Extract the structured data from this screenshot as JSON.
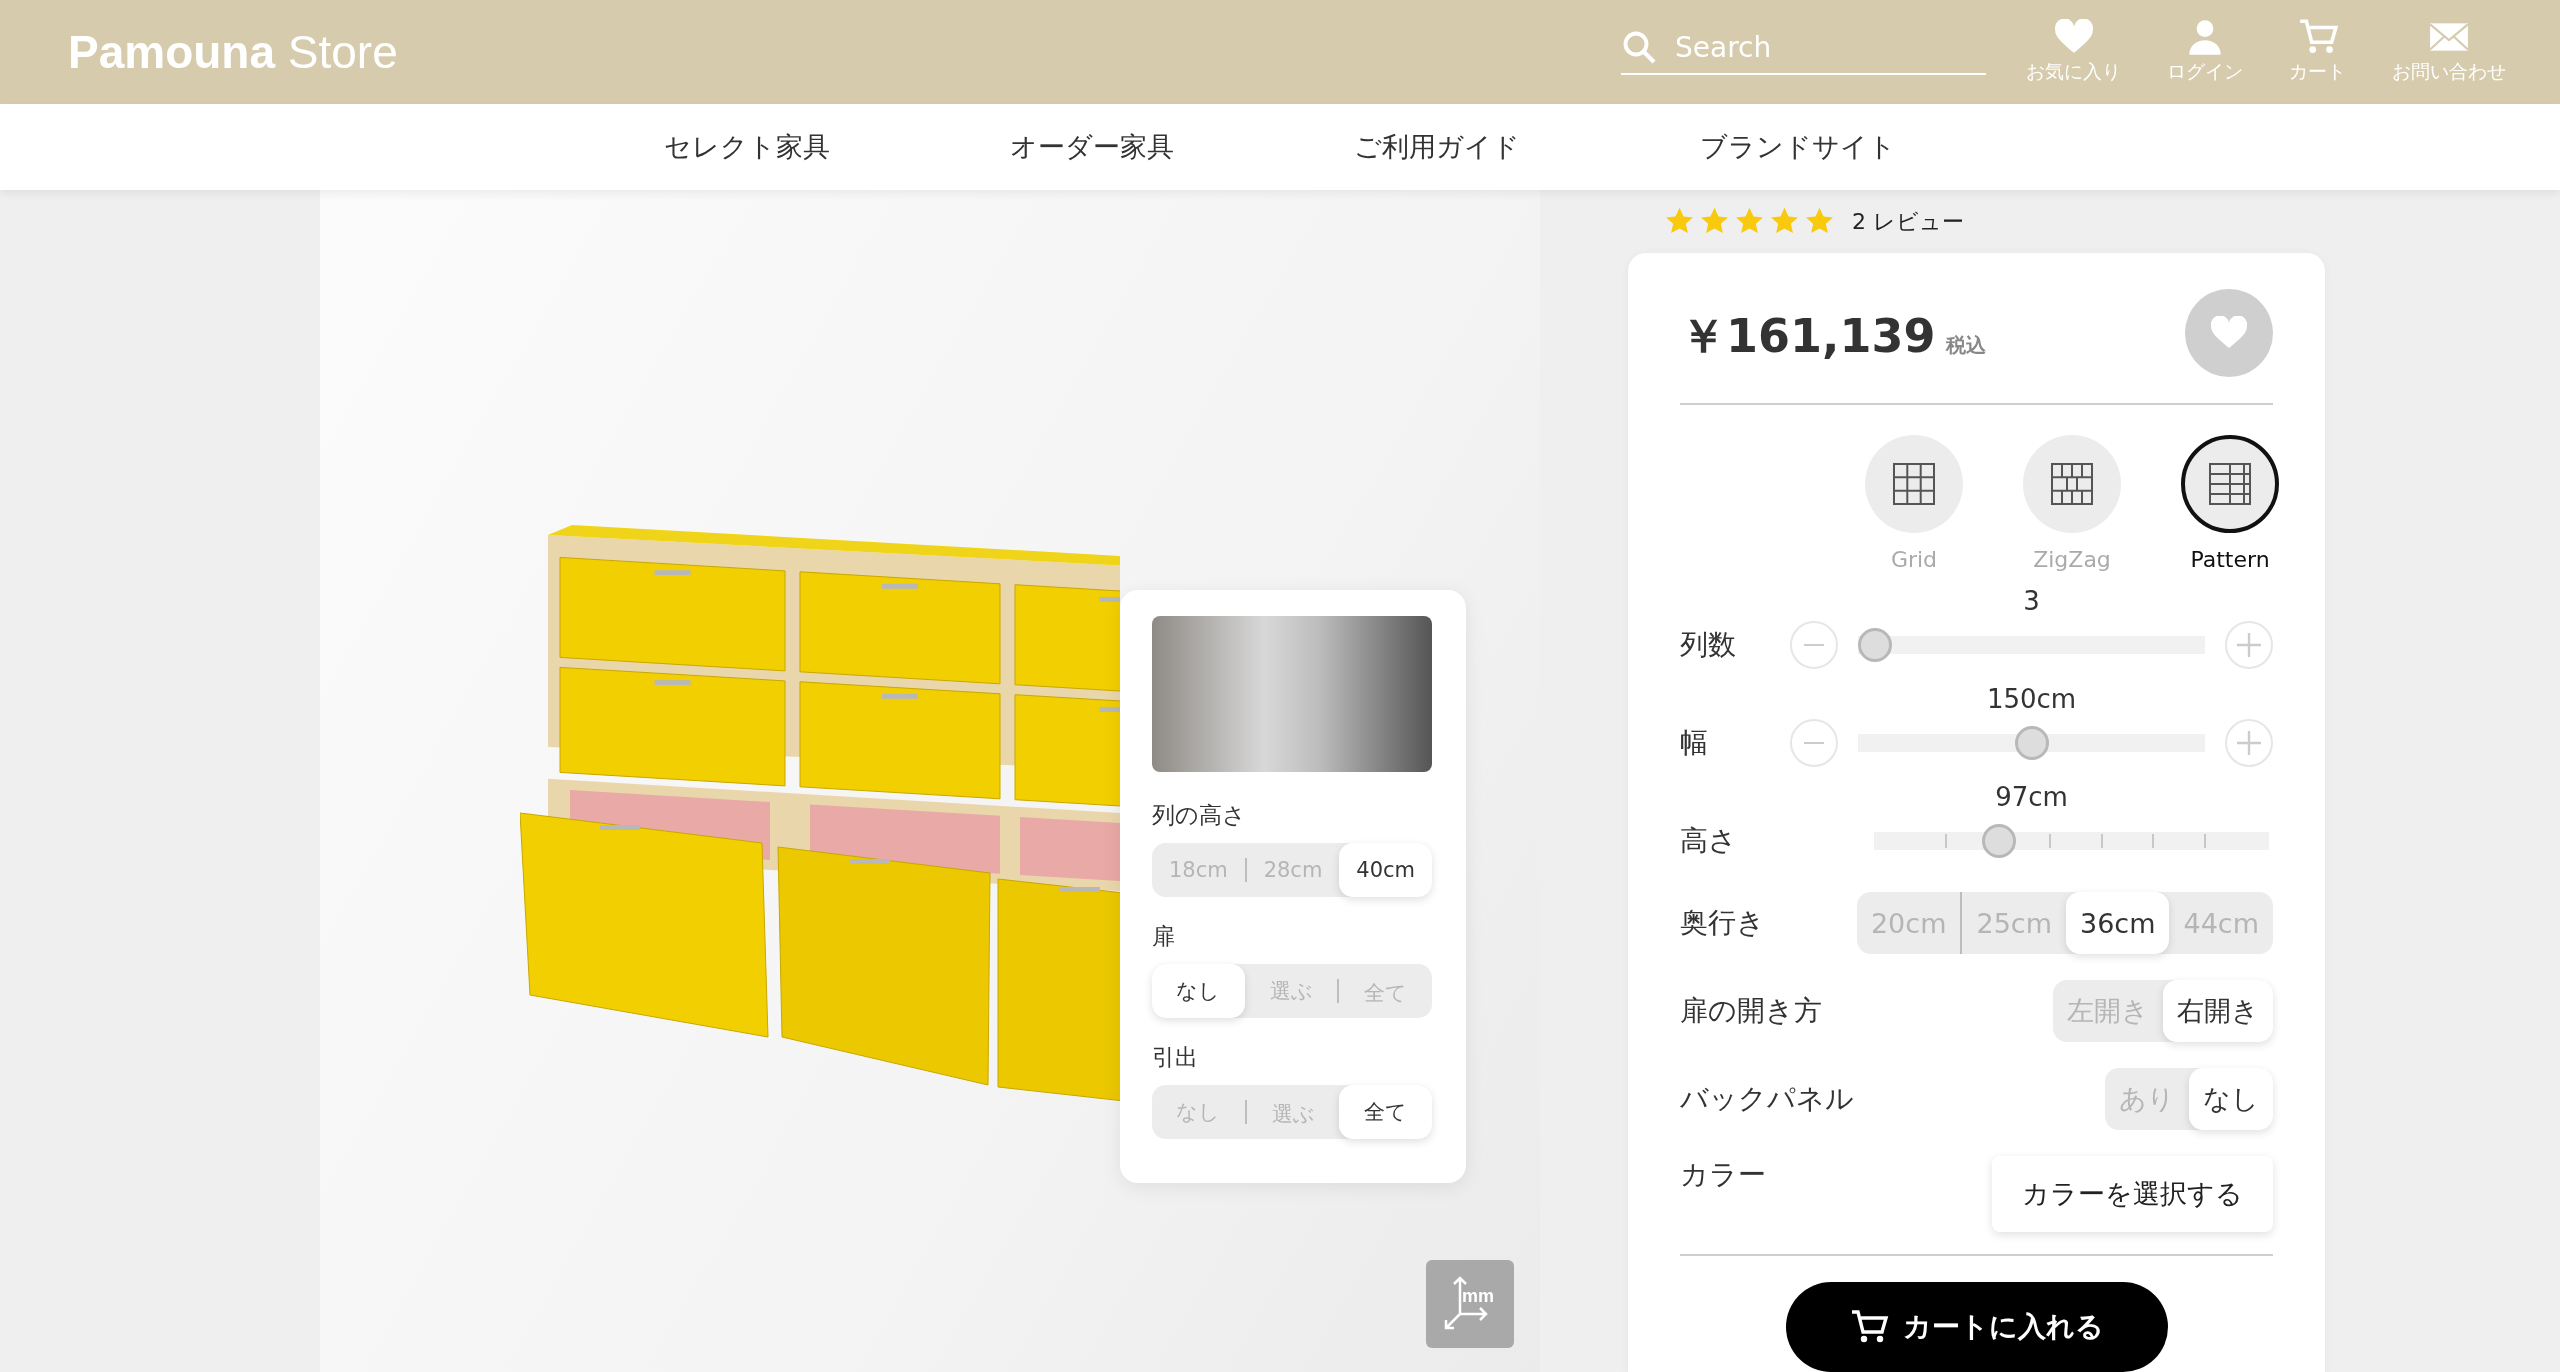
{
  "header": {
    "logo": {
      "brand": "Pamouna",
      "suffix": "Store"
    },
    "search": {
      "placeholder": "Search"
    },
    "actions": [
      {
        "kind": "heart",
        "label": "お気に入り"
      },
      {
        "kind": "person",
        "label": "ログイン"
      },
      {
        "kind": "cart",
        "label": "カート"
      },
      {
        "kind": "mail",
        "label": "お問い合わせ"
      }
    ]
  },
  "nav": [
    "セレクト家具",
    "オーダー家具",
    "ご利用ガイド",
    "ブランドサイト"
  ],
  "viewer": {
    "popup": {
      "groups": [
        {
          "label": "列の高さ",
          "options": [
            {
              "label": "18cm",
              "selected": false
            },
            {
              "label": "28cm",
              "selected": false
            },
            {
              "label": "40cm",
              "selected": true
            }
          ]
        },
        {
          "label": "扉",
          "options": [
            {
              "label": "なし",
              "selected": true
            },
            {
              "label": "選ぶ",
              "selected": false
            },
            {
              "label": "全て",
              "selected": false
            }
          ]
        },
        {
          "label": "引出",
          "options": [
            {
              "label": "なし",
              "selected": false
            },
            {
              "label": "選ぶ",
              "selected": false
            },
            {
              "label": "全て",
              "selected": true
            }
          ]
        }
      ]
    },
    "axis_label": "mm"
  },
  "rating": {
    "stars": 5,
    "label": "2 レビュー"
  },
  "product": {
    "price": "￥161,139",
    "tax": "税込",
    "layouts": [
      {
        "kind": "grid",
        "label": "Grid",
        "selected": false
      },
      {
        "kind": "zigzag",
        "label": "ZigZag",
        "selected": false
      },
      {
        "kind": "pattern",
        "label": "Pattern",
        "selected": true
      }
    ],
    "sliders": [
      {
        "kind": "stepper",
        "label": "列数",
        "value": "3",
        "level": 0
      },
      {
        "kind": "stepper",
        "label": "幅",
        "value": "150cm",
        "level": 0.5
      },
      {
        "kind": "ticks",
        "label": "高さ",
        "value": "97cm",
        "level": 0.3
      }
    ],
    "options": [
      {
        "label": "奥行き",
        "choices": [
          {
            "label": "20cm",
            "selected": false
          },
          {
            "label": "25cm",
            "selected": false
          },
          {
            "label": "36cm",
            "selected": true
          },
          {
            "label": "44cm",
            "selected": false
          }
        ]
      },
      {
        "label": "扉の開き方",
        "choices": [
          {
            "label": "左開き",
            "selected": false
          },
          {
            "label": "右開き",
            "selected": true
          }
        ]
      },
      {
        "label": "バックパネル",
        "choices": [
          {
            "label": "あり",
            "selected": false
          },
          {
            "label": "なし",
            "selected": true
          }
        ]
      }
    ],
    "color": {
      "label": "カラー",
      "button": "カラーを選択する"
    },
    "cart_button": "カートに入れる"
  }
}
